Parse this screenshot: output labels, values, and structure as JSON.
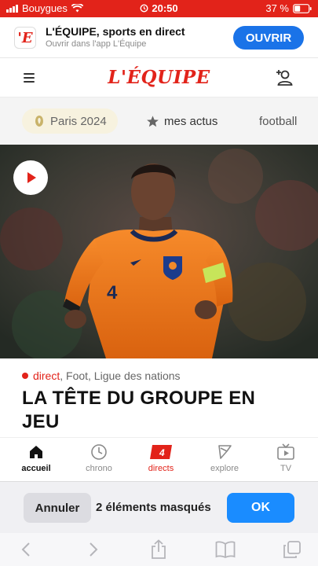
{
  "status_bar": {
    "carrier": "Bouygues",
    "time": "20:50",
    "battery": "37 %",
    "icons": [
      "signal-icon",
      "wifi-icon",
      "alarm-icon",
      "battery-icon"
    ]
  },
  "app_banner": {
    "logo_letter": "'E",
    "title": "L'ÉQUIPE, sports en direct",
    "subtitle": "Ouvrir dans l'app L'Équipe",
    "open_label": "OUVRIR"
  },
  "header": {
    "logo": "L'ÉQUIPE",
    "icons": [
      "menu-icon",
      "profile-add-icon"
    ]
  },
  "tabs": [
    {
      "label": "Paris 2024",
      "icon": "paris-2024-icon"
    },
    {
      "label": "mes actus",
      "icon": "star-icon"
    },
    {
      "label": "football",
      "icon": ""
    }
  ],
  "hero": {
    "player_number": "4",
    "icon": "play-icon"
  },
  "article": {
    "live_label": "direct",
    "meta": ", Foot, Ligue des nations",
    "headline": "LA TÊTE DU GROUPE EN JEU"
  },
  "bottom_nav": [
    {
      "label": "accueil",
      "icon": "home-icon"
    },
    {
      "label": "chrono",
      "icon": "clock-icon"
    },
    {
      "label": "directs",
      "icon": "directs-icon",
      "badge": "4"
    },
    {
      "label": "explore",
      "icon": "explore-icon"
    },
    {
      "label": "TV",
      "icon": "tv-icon"
    }
  ],
  "blocker": {
    "cancel_label": "Annuler",
    "message": "2 éléments masqués",
    "ok_label": "OK"
  },
  "safari_toolbar": {
    "icons": [
      "back-icon",
      "forward-icon",
      "share-icon",
      "bookmarks-icon",
      "tabs-icon"
    ]
  },
  "colors": {
    "brand_red": "#e2231a",
    "accent_blue": "#1a73e8",
    "ok_blue": "#1a8cff",
    "jersey_orange": "#f07a1a"
  }
}
